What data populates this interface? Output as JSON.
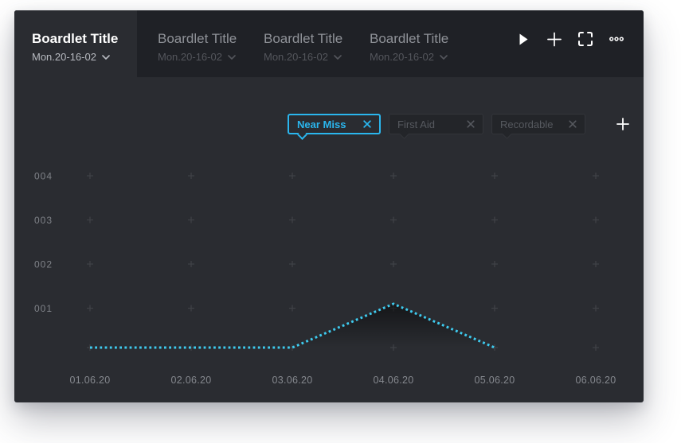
{
  "tabs": [
    {
      "title": "Boardlet Title",
      "subtitle": "Mon.20-16-02",
      "active": true
    },
    {
      "title": "Boardlet Title",
      "subtitle": "Mon.20-16-02",
      "active": false
    },
    {
      "title": "Boardlet Title",
      "subtitle": "Mon.20-16-02",
      "active": false
    },
    {
      "title": "Boardlet Title",
      "subtitle": "Mon.20-16-02",
      "active": false
    }
  ],
  "toolbar": {
    "icons": [
      {
        "name": "play-icon",
        "glyph": "▶"
      },
      {
        "name": "add-boardlet-icon",
        "glyph": "+"
      },
      {
        "name": "fullscreen-icon",
        "glyph": "⛶"
      },
      {
        "name": "more-options-icon",
        "glyph": "•••"
      }
    ]
  },
  "filters": {
    "chips": [
      {
        "label": "Near Miss",
        "state": "active",
        "close_glyph": "✕"
      },
      {
        "label": "First Aid",
        "state": "default",
        "close_glyph": "✕"
      },
      {
        "label": "Recordable",
        "state": "default",
        "close_glyph": "✕"
      }
    ],
    "add_button_glyph": "+"
  },
  "chart_data": {
    "type": "line",
    "line_style": "dotted",
    "x": [
      "01.06.20",
      "02.06.20",
      "03.06.20",
      "04.06.20",
      "05.06.20",
      "06.06.20"
    ],
    "series": [
      {
        "name": "Near Miss",
        "color": "#3ecbef",
        "values": [
          0,
          0,
          0,
          1,
          0,
          null
        ]
      }
    ],
    "yticks": [
      "004",
      "003",
      "002",
      "001"
    ],
    "ytick_values": [
      4,
      3,
      2,
      1
    ],
    "ylim": [
      0,
      4.5
    ],
    "grid": "plus-markers",
    "legend": "none"
  },
  "colors": {
    "accent": "#2ab6ee",
    "line": "#3ecbef",
    "header_bg": "#1f2126",
    "body_bg": "#2a2c31",
    "chip_muted_bg": "#232529",
    "chip_muted_border": "#33353a",
    "chip_muted_text": "#56595f",
    "axis_text": "#85888e",
    "ytick_text": "#7f8288",
    "grid_marker": "#3f4146",
    "tab_active_title": "#ffffff",
    "tab_inactive_title": "#8f9298",
    "tab_active_subtitle": "#b7bac0",
    "tab_inactive_subtitle": "#54565c"
  }
}
